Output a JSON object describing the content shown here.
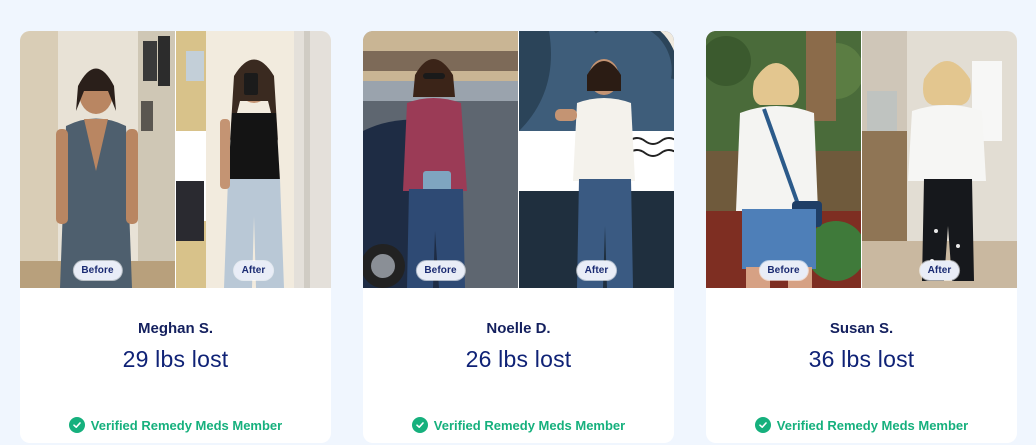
{
  "testimonials": [
    {
      "name": "Meghan S.",
      "lost": "29 lbs lost",
      "before_label": "Before",
      "after_label": "After",
      "verified": "Verified Remedy Meds Member"
    },
    {
      "name": "Noelle D.",
      "lost": "26 lbs lost",
      "before_label": "Before",
      "after_label": "After",
      "verified": "Verified Remedy Meds Member"
    },
    {
      "name": "Susan S.",
      "lost": "36 lbs lost",
      "before_label": "Before",
      "after_label": "After",
      "verified": "Verified Remedy Meds Member"
    }
  ],
  "colors": {
    "background": "#f0f6fe",
    "card": "#ffffff",
    "name": "#14205e",
    "lost": "#0f2276",
    "verified": "#16b07d"
  },
  "icons": {
    "verified_icon": "check-circle-icon"
  }
}
